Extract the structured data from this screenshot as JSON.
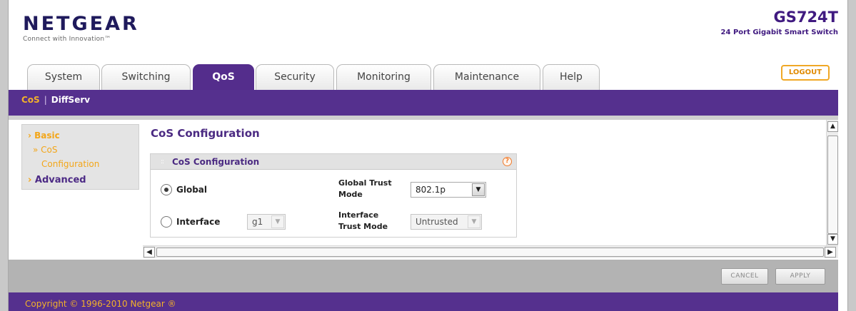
{
  "header": {
    "brand": "NETGEAR",
    "tagline": "Connect with Innovation™",
    "model_name": "GS724T",
    "model_desc": "24 Port Gigabit Smart Switch",
    "logout_label": "LOGOUT"
  },
  "tabs": [
    {
      "label": "System"
    },
    {
      "label": "Switching"
    },
    {
      "label": "QoS",
      "active": true
    },
    {
      "label": "Security"
    },
    {
      "label": "Monitoring"
    },
    {
      "label": "Maintenance"
    },
    {
      "label": "Help"
    }
  ],
  "subnav": {
    "items": [
      {
        "label": "CoS",
        "active": true
      },
      {
        "label": "DiffServ"
      }
    ],
    "separator": "|"
  },
  "sidebar": {
    "basic": "Basic",
    "cos_config": "CoS Configuration",
    "cos_line1": "CoS",
    "cos_line2": "Configuration",
    "advanced": "Advanced"
  },
  "main": {
    "page_title": "CoS Configuration",
    "panel_title": "CoS Configuration",
    "global_label": "Global",
    "interface_label": "Interface",
    "interface_value": "g1",
    "global_trust_label1": "Global Trust",
    "global_trust_label2": "Mode",
    "global_trust_value": "802.1p",
    "interface_trust_label1": "Interface",
    "interface_trust_label2": "Trust Mode",
    "interface_trust_value": "Untrusted",
    "selected_scope": "Global"
  },
  "actions": {
    "cancel": "CANCEL",
    "apply": "APPLY"
  },
  "footer": {
    "copyright": "Copyright © 1996-2010 Netgear ®"
  },
  "colors": {
    "purple": "#55308e",
    "orange": "#f3a619"
  }
}
